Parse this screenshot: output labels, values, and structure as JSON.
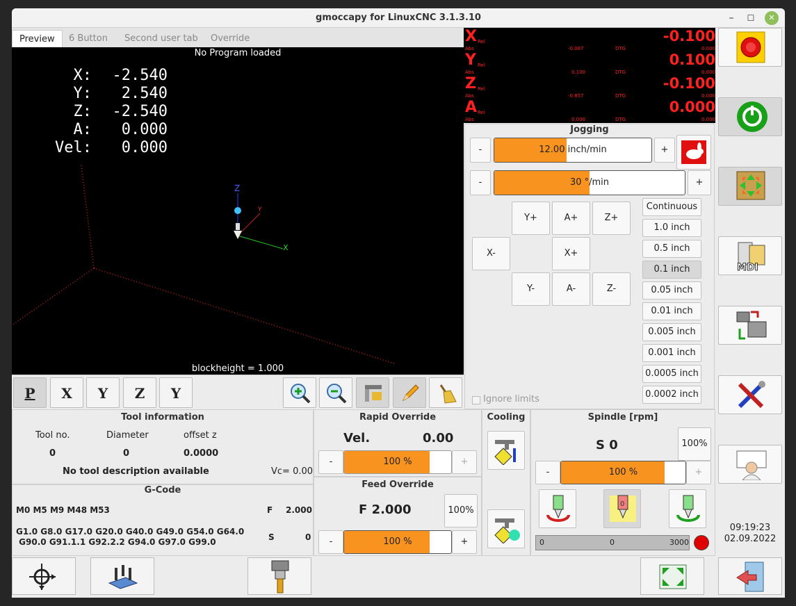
{
  "window": {
    "title": "gmoccapy for LinuxCNC  3.1.3.10",
    "min": "–",
    "max": "☐",
    "close": "✕"
  },
  "tabs": [
    "Preview",
    "6 Button",
    "Second user tab",
    "Override"
  ],
  "preview": {
    "status": "No Program loaded",
    "blockheight": "blockheight = 1.000",
    "dro": [
      {
        "axis": "X:",
        "value": "-2.540"
      },
      {
        "axis": "Y:",
        "value": "2.540"
      },
      {
        "axis": "Z:",
        "value": "-2.540"
      },
      {
        "axis": "A:",
        "value": "0.000"
      },
      {
        "axis": "Vel:",
        "value": "0.000"
      }
    ],
    "axis_labels": {
      "x": "X",
      "y": "Y",
      "z": "Z"
    }
  },
  "preview_toolbar": {
    "p": "P",
    "x": "X",
    "y": "Y",
    "z": "Z",
    "y2": "Y"
  },
  "dro_panel": [
    {
      "axis": "X",
      "rel": "Rel",
      "abs": "Abs",
      "value": "-0.100",
      "abs_val": "-0.087",
      "dtg": "DTG",
      "dtg_val": "0.000"
    },
    {
      "axis": "Y",
      "rel": "Rel",
      "abs": "Abs",
      "value": "0.100",
      "abs_val": "0.100",
      "dtg": "DTG",
      "dtg_val": "0.000"
    },
    {
      "axis": "Z",
      "rel": "Rel",
      "abs": "Abs",
      "value": "-0.100",
      "abs_val": "-0.857",
      "dtg": "DTG",
      "dtg_val": "0.000"
    },
    {
      "axis": "A",
      "rel": "Rel",
      "abs": "Abs",
      "value": "0.000",
      "abs_val": "0.000",
      "dtg": "DTG",
      "dtg_val": "0.000"
    }
  ],
  "jogging": {
    "title": "Jogging",
    "minus": "-",
    "plus": "+",
    "linear_speed": {
      "label": "12.00 inch/min",
      "fraction": 0.46
    },
    "angular_speed": {
      "label": "30 °/min",
      "fraction": 0.5
    },
    "buttons": {
      "yp": "Y+",
      "ap": "A+",
      "zp": "Z+",
      "xm": "X-",
      "xp": "X+",
      "ym": "Y-",
      "am": "A-",
      "zm": "Z-"
    },
    "increments": [
      "Continuous",
      "1.0 inch",
      "0.5 inch",
      "0.1 inch",
      "0.05 inch",
      "0.01 inch",
      "0.005 inch",
      "0.001 inch",
      "0.0005 inch",
      "0.0002 inch"
    ],
    "selected_increment": "0.1 inch",
    "ignore_limits": "Ignore limits"
  },
  "tool_info": {
    "title": "Tool information",
    "tool_no_label": "Tool no.",
    "diameter_label": "Diameter",
    "offset_label": "offset z",
    "tool_no": "0",
    "diameter": "0",
    "offset": "0.0000",
    "desc": "No tool description available",
    "vc": "Vc= 0.00"
  },
  "gcode": {
    "title": "G-Code",
    "mcodes": "M0 M5 M9 M48 M53",
    "line1": "G1.0 G8.0 G17.0 G20.0 G40.0 G49.0 G54.0 G64.0",
    "line2": " G90.0 G91.1.1 G92.2.2 G94.0 G97.0 G99.0",
    "f_label": "F",
    "f_val": "2.000",
    "s_label": "S",
    "s_val": "0"
  },
  "rapid": {
    "title": "Rapid Override",
    "vel_label": "Vel.",
    "vel_val": "0.00",
    "value": "100 %",
    "fraction": 0.8,
    "minus": "-",
    "plus": "+"
  },
  "feed": {
    "title": "Feed Override",
    "f": "F 2.000",
    "reset": "100%",
    "value": "100 %",
    "fraction": 0.8,
    "minus": "-",
    "plus": "+"
  },
  "cooling": {
    "title": "Cooling"
  },
  "spindle": {
    "title": "Spindle [rpm]",
    "s": "S 0",
    "reset": "100%",
    "value": "100 %",
    "fraction": 0.83,
    "minus": "-",
    "plus": "+",
    "bar_min": "0",
    "bar_val": "0",
    "bar_max": "3000",
    "led_color": "#e00000"
  },
  "clock": {
    "time": "09:19:23",
    "date": "02.09.2022"
  }
}
